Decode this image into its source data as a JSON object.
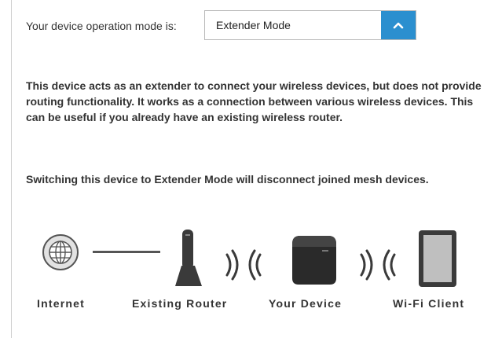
{
  "mode": {
    "label": "Your device operation mode is:",
    "selected": "Extender Mode",
    "toggle_icon": "chevron-up-icon",
    "accent": "#2b8fcf"
  },
  "description": "This device acts as an extender to connect your wireless devices, but does not provide routing functionality. It works as a connection between various wireless devices. This can be useful if you already have an existing wireless router.",
  "warning": "Switching this device to Extender Mode will disconnect joined mesh devices.",
  "diagram": {
    "internet_label": "Internet",
    "router_label": "Existing Router",
    "device_label": "Your Device",
    "client_label": "Wi-Fi Client",
    "icons": [
      "globe-icon",
      "router-icon",
      "wifi-signal-icon",
      "extender-device-icon",
      "wifi-signal-icon",
      "tablet-icon"
    ]
  }
}
